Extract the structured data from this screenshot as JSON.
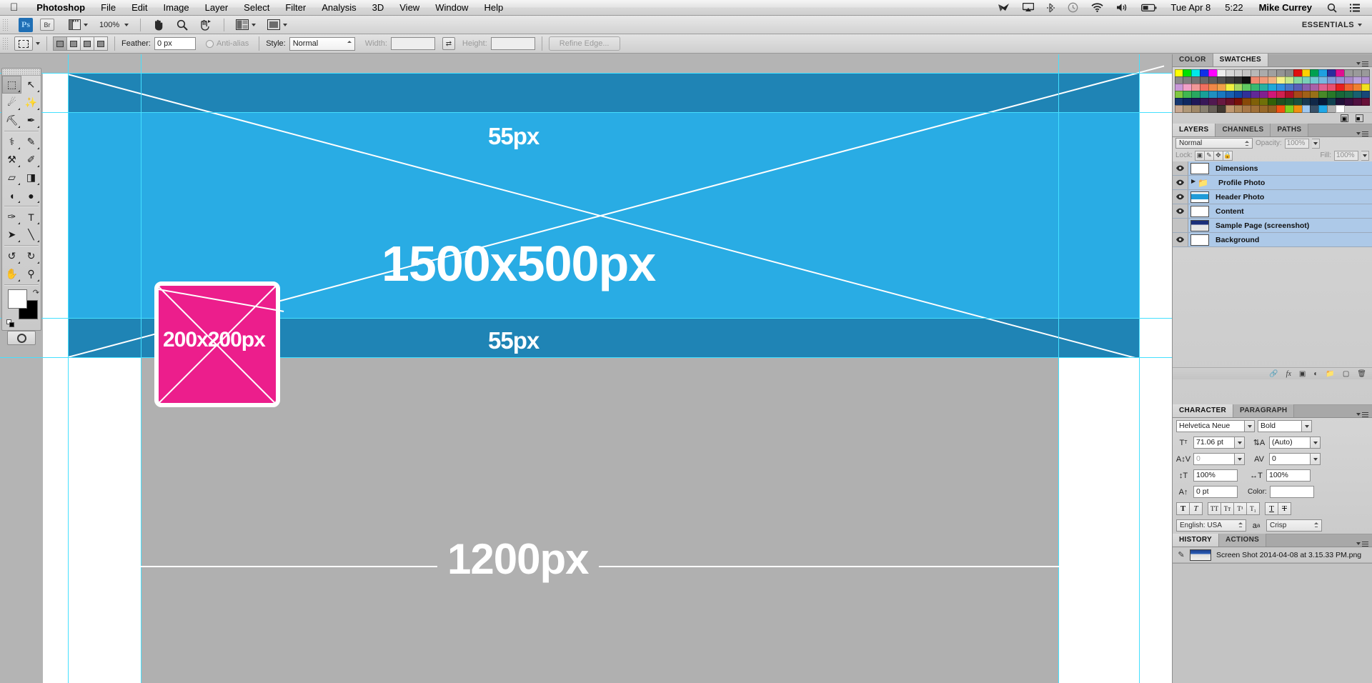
{
  "menubar": {
    "apple_icon": "apple-icon",
    "items": [
      "Photoshop",
      "File",
      "Edit",
      "Image",
      "Layer",
      "Select",
      "Filter",
      "Analysis",
      "3D",
      "View",
      "Window",
      "Help"
    ],
    "status_icons": [
      "origami-crane-icon",
      "airplay-icon",
      "bluetooth-icon",
      "time-machine-icon",
      "wifi-icon",
      "volume-icon",
      "battery-icon"
    ],
    "date": "Tue Apr 8",
    "time": "5:22",
    "user": "Mike Currey",
    "search_icon": "search-icon",
    "notification_icon": "notification-center-icon"
  },
  "appbar": {
    "logo": "Ps",
    "bridge_label": "Br",
    "mini_bridge_icon": "mini-bridge-icon",
    "zoom_level": "100%",
    "hand_icon": "hand-tool-icon",
    "zoom_icon": "zoom-tool-icon",
    "rotate_icon": "rotate-view-icon",
    "arrange_icon": "arrange-documents-icon",
    "screenmode_icon": "screen-mode-icon",
    "workspace": "ESSENTIALS"
  },
  "optionsbar": {
    "tool_icon": "rectangular-marquee-icon",
    "selection_modes": [
      "new-selection",
      "add-to-selection",
      "subtract-from-selection",
      "intersect-selection"
    ],
    "feather_label": "Feather:",
    "feather_value": "0 px",
    "antialias_label": "Anti-alias",
    "style_label": "Style:",
    "style_value": "Normal",
    "width_label": "Width:",
    "width_value": "",
    "swap_icon": "swap-width-height-icon",
    "height_label": "Height:",
    "height_value": "",
    "refine_edge": "Refine Edge..."
  },
  "toolbox": {
    "tools": [
      {
        "name": "rectangular-marquee-tool",
        "glyph": "⬚",
        "selected": true
      },
      {
        "name": "move-tool",
        "glyph": "↖"
      },
      {
        "name": "lasso-tool",
        "glyph": "☄"
      },
      {
        "name": "magic-wand-tool",
        "glyph": "✨"
      },
      {
        "name": "crop-tool",
        "glyph": "⛏"
      },
      {
        "name": "eyedropper-tool",
        "glyph": "✒"
      },
      {
        "name": "spot-healing-brush-tool",
        "glyph": "⚕"
      },
      {
        "name": "brush-tool",
        "glyph": "✎"
      },
      {
        "name": "clone-stamp-tool",
        "glyph": "⚒"
      },
      {
        "name": "history-brush-tool",
        "glyph": "✐"
      },
      {
        "name": "eraser-tool",
        "glyph": "▱"
      },
      {
        "name": "gradient-tool",
        "glyph": "◨"
      },
      {
        "name": "blur-tool",
        "glyph": "◖"
      },
      {
        "name": "dodge-tool",
        "glyph": "●"
      },
      {
        "name": "pen-tool",
        "glyph": "✑"
      },
      {
        "name": "type-tool",
        "glyph": "T"
      },
      {
        "name": "path-selection-tool",
        "glyph": "➤"
      },
      {
        "name": "line-tool",
        "glyph": "╲"
      },
      {
        "name": "3d-object-rotate-tool",
        "glyph": "↺"
      },
      {
        "name": "3d-camera-rotate-tool",
        "glyph": "↻"
      },
      {
        "name": "hand-tool",
        "glyph": "✋"
      },
      {
        "name": "zoom-tool",
        "glyph": "⚲"
      }
    ],
    "foreground_color": "#ffffff",
    "background_color": "#000000",
    "quickmask_icon": "quick-mask-icon"
  },
  "canvas": {
    "header_label_top": "55px",
    "header_label_bottom": "55px",
    "header_main_label": "1500x500px",
    "avatar_label": "200x200px",
    "content_label": "1200px",
    "colors": {
      "band_dark": "#1f84b5",
      "band_light": "#29ace4",
      "avatar_pink": "#ec1e8c",
      "content_gray": "#b0b0b0",
      "guide_cyan": "#44e0ff",
      "canvas_white": "#ffffff"
    }
  },
  "color_panel": {
    "tabs": [
      {
        "label": "COLOR",
        "active": false
      },
      {
        "label": "SWATCHES",
        "active": true
      }
    ],
    "swatches": [
      "#ffff00",
      "#00e000",
      "#00e8e8",
      "#1030e8",
      "#ff00ff",
      "#ededed",
      "#d8d8d8",
      "#d0d0d0",
      "#c4c4c4",
      "#b8b8b8",
      "#ababab",
      "#a0a0a0",
      "#949494",
      "#8a8a8a",
      "#e01010",
      "#ffd000",
      "#00a050",
      "#1fa0e0",
      "#2c2c9c",
      "#e01090",
      "#9a9a9a",
      "#9a9a9a",
      "#9a9a9a",
      "#8a8a8a",
      "#7e7e7e",
      "#727272",
      "#686868",
      "#5c5c5c",
      "#505050",
      "#3e3e3e",
      "#303030",
      "#101010",
      "#f08870",
      "#f09878",
      "#f0b080",
      "#f5f088",
      "#c8e888",
      "#88d8a0",
      "#78d0b8",
      "#70c8d0",
      "#78b8e0",
      "#8098d8",
      "#9890d0",
      "#a888c8",
      "#b8a0d8",
      "#b090d0",
      "#c898d8",
      "#f0a0c8",
      "#f09898",
      "#f07060",
      "#f08848",
      "#f0a048",
      "#f0f040",
      "#a8d860",
      "#60c860",
      "#38b870",
      "#28b0a0",
      "#20a8d8",
      "#3090e0",
      "#4878c8",
      "#5860b8",
      "#8860b0",
      "#a860a8",
      "#e06090",
      "#e85070",
      "#e82020",
      "#f06030",
      "#f08030",
      "#f0e020",
      "#80c840",
      "#40b850",
      "#28a860",
      "#18a098",
      "#2090c0",
      "#1878c0",
      "#1860b0",
      "#1048a0",
      "#303098",
      "#602898",
      "#802090",
      "#d01878",
      "#d02050",
      "#b01028",
      "#a84818",
      "#a06018",
      "#987018",
      "#488828",
      "#287828",
      "#186838",
      "#1a6848",
      "#186070",
      "#184878",
      "#183870",
      "#102860",
      "#201858",
      "#381858",
      "#501850",
      "#681840",
      "#681028",
      "#781008",
      "#884808",
      "#806008",
      "#707008",
      "#306008",
      "#205020",
      "#185828",
      "#18503f",
      "#183850",
      "#102848",
      "#081838",
      "#10404f",
      "#201038",
      "#381040",
      "#501040",
      "#681038",
      "#c8a890",
      "#b09878",
      "#a08868",
      "#888070",
      "#686058",
      "#403830",
      "#c09870",
      "#b08858",
      "#a87848",
      "#a07038",
      "#986828",
      "#906020",
      "#f05010",
      "#80d020",
      "#f09010",
      "#a0c8f0",
      "#385068",
      "#20a8e8",
      "#b0b0b0",
      "#ffffff"
    ],
    "footer_icons": [
      "new-swatch-icon",
      "delete-swatch-icon"
    ]
  },
  "layers_panel": {
    "tabs": [
      {
        "label": "LAYERS",
        "active": true
      },
      {
        "label": "CHANNELS",
        "active": false
      },
      {
        "label": "PATHS",
        "active": false
      }
    ],
    "blend_mode": "Normal",
    "opacity_label": "Opacity:",
    "opacity_value": "100%",
    "lock_label": "Lock:",
    "lock_buttons": [
      "lock-transparent-pixels-icon",
      "lock-image-pixels-icon",
      "lock-position-icon",
      "lock-all-icon"
    ],
    "fill_label": "Fill:",
    "fill_value": "100%",
    "layers": [
      {
        "name": "Dimensions",
        "visible": true,
        "type": "transparent",
        "group": false
      },
      {
        "name": "Profile Photo",
        "visible": true,
        "type": "folder",
        "group": true
      },
      {
        "name": "Header Photo",
        "visible": true,
        "type": "blue",
        "group": false
      },
      {
        "name": "Content",
        "visible": true,
        "type": "transparent",
        "group": false
      },
      {
        "name": "Sample Page (screenshot)",
        "visible": false,
        "type": "screenshot",
        "group": false
      },
      {
        "name": "Background",
        "visible": true,
        "type": "white",
        "group": false
      }
    ],
    "footer_icons": [
      "link-layers-icon",
      "layer-style-icon",
      "layer-mask-icon",
      "adjustment-layer-icon",
      "new-group-icon",
      "new-layer-icon",
      "delete-layer-icon"
    ]
  },
  "character_panel": {
    "tabs": [
      {
        "label": "CHARACTER",
        "active": true
      },
      {
        "label": "PARAGRAPH",
        "active": false
      }
    ],
    "font_family": "Helvetica Neue",
    "font_style": "Bold",
    "font_size_icon": "font-size-icon",
    "font_size": "71.06 pt",
    "leading_icon": "leading-icon",
    "leading": "(Auto)",
    "kerning_icon": "kerning-icon",
    "kerning": "0",
    "tracking_icon": "tracking-icon",
    "tracking": "0",
    "vertical_scale_icon": "vertical-scale-icon",
    "vertical_scale": "100%",
    "horizontal_scale_icon": "horizontal-scale-icon",
    "horizontal_scale": "100%",
    "baseline_icon": "baseline-shift-icon",
    "baseline_shift": "0 pt",
    "color_label": "Color:",
    "color_value": "#ffffff",
    "style_buttons": [
      "faux-bold",
      "faux-italic",
      "all-caps",
      "small-caps",
      "superscript",
      "subscript",
      "underline",
      "strikethrough"
    ],
    "language": "English: USA",
    "antialias_icon": "anti-alias-icon",
    "antialias_method": "Crisp"
  },
  "history_panel": {
    "tabs": [
      {
        "label": "HISTORY",
        "active": true
      },
      {
        "label": "ACTIONS",
        "active": false
      }
    ],
    "snapshot_icon": "history-snapshot-icon",
    "snapshot_name": "Screen Shot 2014-04-08 at 3.15.33 PM.png"
  }
}
